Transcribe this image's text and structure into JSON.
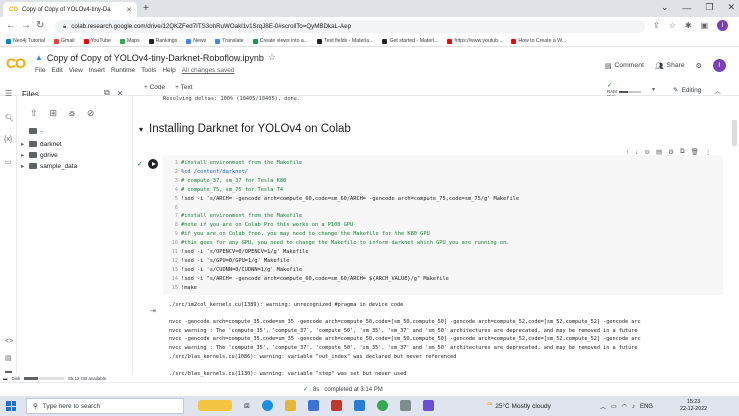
{
  "browser": {
    "tab_title": "Copy of Copy of YOLOv4-tiny-Da",
    "url": "colab.research.google.com/drive/12QKZFed7ITS3ohRuWOakl1v1SrqJ8E-0#scrollTo=QyMBDkaL-Aep",
    "bookmarks": [
      {
        "label": "Neo4j Tutorial",
        "color": "#008cc1"
      },
      {
        "label": "Gmail",
        "color": "#ea4335"
      },
      {
        "label": "YouTube",
        "color": "#ff0000"
      },
      {
        "label": "Maps",
        "color": "#34a853"
      },
      {
        "label": "Rankings",
        "color": "#202124"
      },
      {
        "label": "News",
        "color": "#4285f4"
      },
      {
        "label": "Translate",
        "color": "#4285f4"
      },
      {
        "label": "Create views into a...",
        "color": "#0f9d58"
      },
      {
        "label": "Text fields - Materia...",
        "color": "#202124"
      },
      {
        "label": "Get started - Materi...",
        "color": "#202124"
      },
      {
        "label": "https://www.youtub...",
        "color": "#ff0000"
      },
      {
        "label": "How to Create a W...",
        "color": "#ff0000"
      }
    ],
    "profile_initial": "I"
  },
  "colab": {
    "logo": "CO",
    "notebook_title": "Copy of Copy of YOLOv4-tiny-Darknet-Roboflow.ipynb",
    "menu": [
      "File",
      "Edit",
      "View",
      "Insert",
      "Runtime",
      "Tools",
      "Help"
    ],
    "all_changes": "All changes saved",
    "comment_label": "Comment",
    "share_label": "Share",
    "user_initial": "I",
    "code_btn": "+ Code",
    "text_btn": "+ Text",
    "ram_label": "RAM",
    "disk_label": "Disk",
    "editing_label": "Editing"
  },
  "sidebar": {
    "title": "Files",
    "items": [
      {
        "label": ".."
      },
      {
        "label": "darknet"
      },
      {
        "label": "gdrive"
      },
      {
        "label": "sample_data"
      }
    ],
    "disk_label": "Disk",
    "disk_value": "55.12 GB available",
    "disk_fraction": 0.35
  },
  "main": {
    "prev_output": "Resolving deltas: 100% (10405/10405), done.",
    "section_title": "Installing Darknet for YOLOv4 on Colab",
    "code_lines": [
      {
        "n": "1",
        "text": "#install environment from the Makefile",
        "kind": "comment"
      },
      {
        "n": "2",
        "text": "%cd /content/darknet/",
        "kind": "magic"
      },
      {
        "n": "3",
        "text": "# compute_37, sm_37 for Tesla K80",
        "kind": "comment"
      },
      {
        "n": "4",
        "text": "# compute_75, sm_75 for Tesla T4",
        "kind": "comment"
      },
      {
        "n": "5",
        "text": "!sed -i 's/ARCH= -gencode arch=compute_60,code=sm_60/ARCH= -gencode arch=compute_75,code=sm_75/g' Makefile",
        "kind": "code"
      },
      {
        "n": "6",
        "text": "",
        "kind": "code"
      },
      {
        "n": "7",
        "text": "#install environment from the Makefile",
        "kind": "comment"
      },
      {
        "n": "8",
        "text": "#note if you are on Colab Pro this works on a P100 GPU",
        "kind": "comment"
      },
      {
        "n": "9",
        "text": "#if you are on Colab free, you may need to change the Makefile for the K80 GPU",
        "kind": "comment"
      },
      {
        "n": "10",
        "text": "#this goes for any GPU, you need to change the Makefile to inform darknet which GPU you are running on.",
        "kind": "comment"
      },
      {
        "n": "11",
        "text": "!sed -i 's/OPENCV=0/OPENCV=1/g' Makefile",
        "kind": "code"
      },
      {
        "n": "12",
        "text": "!sed -i 's/GPU=0/GPU=1/g' Makefile",
        "kind": "code"
      },
      {
        "n": "13",
        "text": "!sed -i 's/CUDNN=0/CUDNN=1/g' Makefile",
        "kind": "code"
      },
      {
        "n": "14",
        "text": "!sed -i \"s/ARCH= -gencode arch=compute_60,code=sm_60/ARCH= ${ARCH_VALUE}/g\" Makefile",
        "kind": "code"
      },
      {
        "n": "15",
        "text": "!make",
        "kind": "code"
      }
    ],
    "output_lines": [
      "./src/im2col_kernels.cu(1389): warning: unrecognized #pragma in device code",
      "",
      "nvcc -gencode arch=compute_35,code=sm_35 -gencode arch=compute_50,code=[sm_50,compute_50] -gencode arch=compute_52,code=[sm_52,compute_52] -gencode arc",
      "nvcc warning : The 'compute_35', 'compute_37', 'compute_50', 'sm_35', 'sm_37' and 'sm_50' architectures are deprecated, and may be removed in a future",
      "nvcc -gencode arch=compute_35,code=sm_35 -gencode arch=compute_50,code=[sm_50,compute_50] -gencode arch=compute_52,code=[sm_52,compute_52] -gencode arc",
      "nvcc warning : The 'compute_35', 'compute_37', 'compute_50', 'sm_35', 'sm_37' and 'sm_50' architectures are deprecated, and may be removed in a future",
      "./src/blas_kernels.cu(1086): warning: variable \"out_index\" was declared but never referenced",
      "",
      "./src/blas_kernels.cu(1130): warning: variable \"step\" was set but never used"
    ]
  },
  "status": {
    "elapsed": "8s",
    "completed": "completed at 3:14 PM"
  },
  "taskbar": {
    "search_placeholder": "Type here to search",
    "weather": "25°C  Mostly cloudy",
    "language": "ENG",
    "time": "15:23",
    "date": "22-12-2022"
  }
}
